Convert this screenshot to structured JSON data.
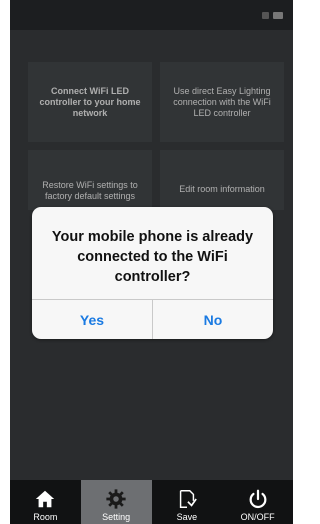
{
  "tiles": [
    {
      "label": "Connect WiFi LED controller to your home network"
    },
    {
      "label": "Use direct Easy Lighting connection with the WiFi LED controller"
    },
    {
      "label": "Restore WiFi settings to factory default settings"
    },
    {
      "label": "Edit room information"
    }
  ],
  "dialog": {
    "message": "Your mobile phone is already connected to the WiFi controller?",
    "yes_label": "Yes",
    "no_label": "No"
  },
  "tabbar": {
    "active": "Setting",
    "tabs": [
      {
        "label": "Room",
        "icon": "home-icon"
      },
      {
        "label": "Setting",
        "icon": "gear-icon"
      },
      {
        "label": "Save",
        "icon": "save-icon"
      },
      {
        "label": "ON/OFF",
        "icon": "power-icon"
      }
    ]
  },
  "colors": {
    "accent": "#1a7ae2",
    "background": "#3b3e41",
    "tabbar": "#111213",
    "active_tab": "#6d6f72"
  }
}
